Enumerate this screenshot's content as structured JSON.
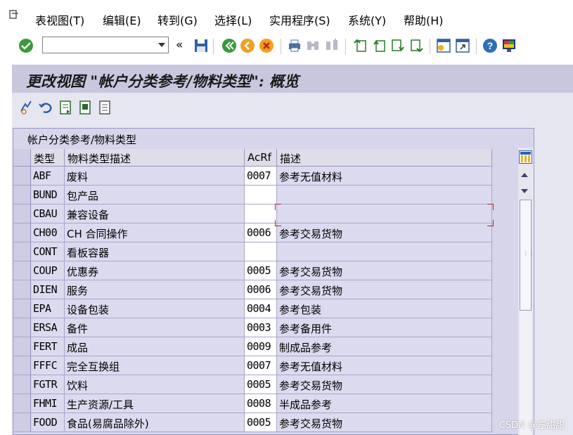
{
  "menu": {
    "items": [
      "表视图(T)",
      "编辑(E)",
      "转到(G)",
      "选择(L)",
      "实用程序(S)",
      "系统(Y)",
      "帮助(H)"
    ]
  },
  "toolbar": {
    "command_value": "",
    "icons": [
      "check-icon",
      "back-icon",
      "save-icon",
      "green-back-icon",
      "exit-icon",
      "cancel-icon",
      "print-icon",
      "find-icon",
      "find-next-icon",
      "first-page-icon",
      "prev-page-icon",
      "next-page-icon",
      "last-page-icon",
      "create-session-icon",
      "shortcut-icon",
      "help-icon",
      "customize-icon"
    ]
  },
  "title": "更改视图 \"帐户分类参考/物料类型\": 概览",
  "app_toolbar": {
    "icons": [
      "display-change-icon",
      "undo-icon",
      "select-all-icon",
      "select-block-icon",
      "deselect-all-icon"
    ]
  },
  "table": {
    "caption": "帐户分类参考/物料类型",
    "headers": {
      "type": "类型",
      "desc": "物料类型描述",
      "acrf": "AcRf",
      "acrf_desc": "描述"
    },
    "rows": [
      {
        "type": "ABF",
        "desc": "废料",
        "acrf": "0007",
        "acrf_desc": "参考无值材料"
      },
      {
        "type": "BUND",
        "desc": "包产品",
        "acrf": "",
        "acrf_desc": ""
      },
      {
        "type": "CBAU",
        "desc": "兼容设备",
        "acrf": "",
        "acrf_desc": ""
      },
      {
        "type": "CH00",
        "desc": "CH 合同操作",
        "acrf": "0006",
        "acrf_desc": "参考交易货物"
      },
      {
        "type": "CONT",
        "desc": "看板容器",
        "acrf": "",
        "acrf_desc": ""
      },
      {
        "type": "COUP",
        "desc": "优惠券",
        "acrf": "0005",
        "acrf_desc": "参考交易货物"
      },
      {
        "type": "DIEN",
        "desc": "服务",
        "acrf": "0006",
        "acrf_desc": "参考交易货物"
      },
      {
        "type": "EPA",
        "desc": "设备包装",
        "acrf": "0004",
        "acrf_desc": "参考包装"
      },
      {
        "type": "ERSA",
        "desc": "备件",
        "acrf": "0003",
        "acrf_desc": "参考备用件"
      },
      {
        "type": "FERT",
        "desc": "成品",
        "acrf": "0009",
        "acrf_desc": "制成品参考"
      },
      {
        "type": "FFFC",
        "desc": "完全互换组",
        "acrf": "0007",
        "acrf_desc": "参考无值材料"
      },
      {
        "type": "FGTR",
        "desc": "饮料",
        "acrf": "0005",
        "acrf_desc": "参考交易货物"
      },
      {
        "type": "FHMI",
        "desc": "生产资源/工具",
        "acrf": "0008",
        "acrf_desc": "半成品参考"
      },
      {
        "type": "FOOD",
        "desc": "食品(易腐品除外)",
        "acrf": "0005",
        "acrf_desc": "参考交易货物"
      }
    ]
  },
  "watermark": "CSDN @左甜甜"
}
